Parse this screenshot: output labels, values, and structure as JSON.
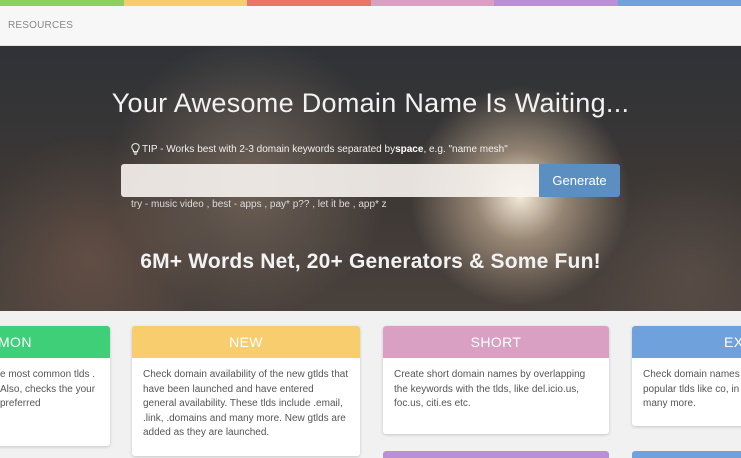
{
  "colors": {
    "strip": [
      "#8fcf5c",
      "#f7cd6e",
      "#ea7468",
      "#d9a0c4",
      "#b88fd8",
      "#6fa1dd"
    ],
    "generate_button": "#5b8fc2",
    "common": "#3ecf78",
    "new": "#f7cd6e",
    "short": "#d9a0c4",
    "ext": "#6fa1dd",
    "peek_short": "#b88fd8",
    "peek_ext": "#6fa1dd"
  },
  "nav": {
    "resources_label": "RESOURCES"
  },
  "hero": {
    "title": "Your Awesome Domain Name Is Waiting...",
    "tip": {
      "icon": "lightbulb-icon",
      "prefix": "TIP - Works best with 2-3 domain keywords separated by ",
      "bold": "space",
      "suffix": ", e.g. \"name mesh\""
    },
    "search": {
      "value": "",
      "placeholder": ""
    },
    "generate_label": "Generate",
    "try_text": "try - music video , best - apps , pay* p?? , let it be , app* z",
    "subtitle": "6M+ Words Net, 20+ Generators & Some Fun!"
  },
  "cards": {
    "common": {
      "title": "MON",
      "body": "e most common tlds . Also, checks the your preferred"
    },
    "new": {
      "title": "NEW",
      "body": "Check domain availability of the new gtlds that have been launched and have entered general availability. These tlds include .email, .link, .domains and many more. New gtlds are added as they are launched."
    },
    "short": {
      "title": "SHORT",
      "body": "Create short domain names by overlapping the keywords with the tlds, like del.icio.us, foc.us, citi.es etc."
    },
    "ext": {
      "title": "EX",
      "body": "Check domain names popular tlds like co, in and many more."
    }
  }
}
